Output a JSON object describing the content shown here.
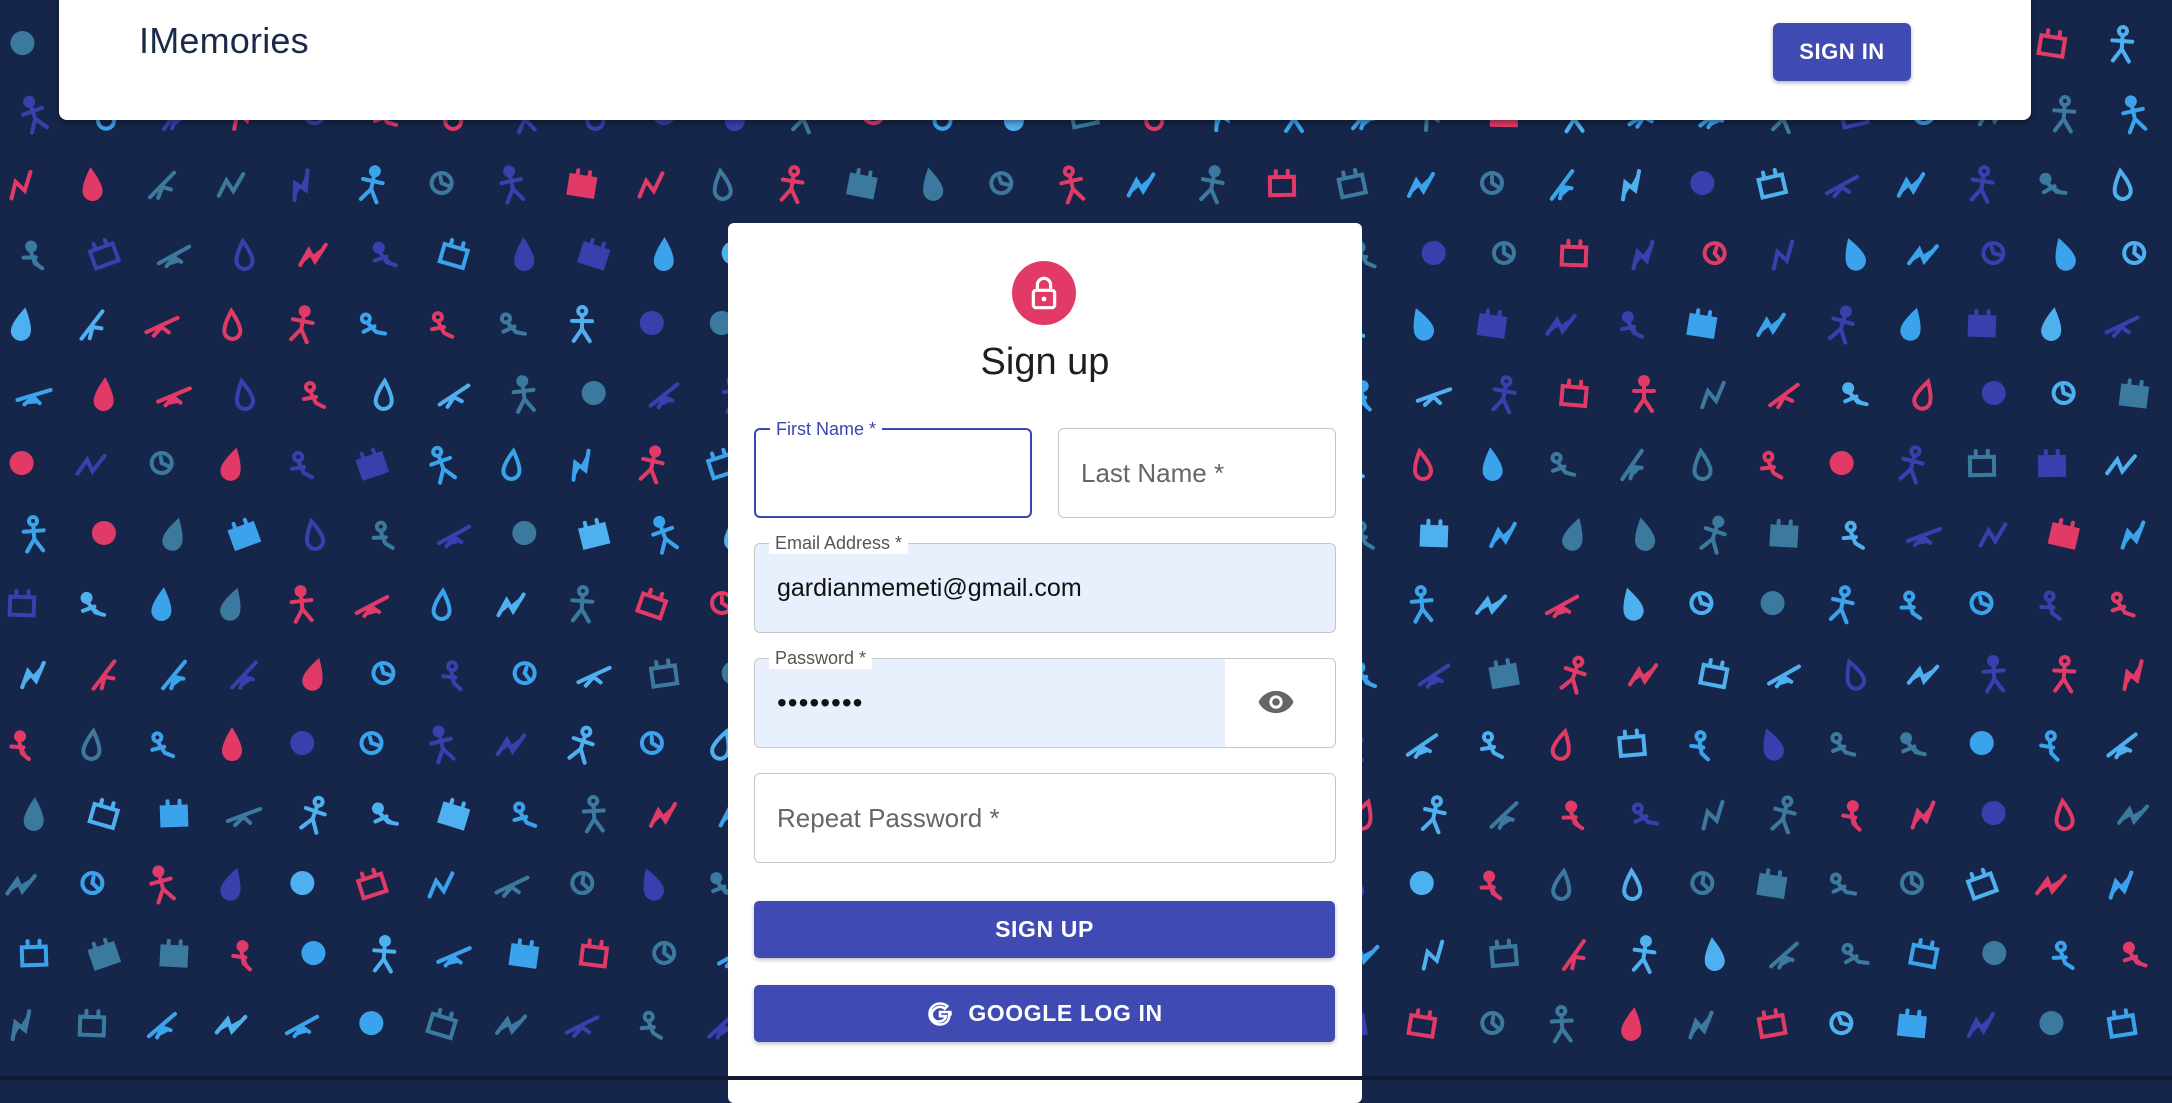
{
  "app": {
    "brand": "IMemories",
    "signin_label": "SIGN IN"
  },
  "form": {
    "title": "Sign up",
    "first_name": {
      "label": "First Name *",
      "value": ""
    },
    "last_name": {
      "placeholder": "Last Name *"
    },
    "email": {
      "label": "Email Address *",
      "value": "gardianmemeti@gmail.com"
    },
    "password": {
      "label": "Password *",
      "value": "••••••••"
    },
    "repeat_password": {
      "placeholder": "Repeat Password *"
    },
    "signup_label": "SIGN UP",
    "google_label": "GOOGLE LOG IN"
  },
  "colors": {
    "background": "#16264a",
    "primary": "#3f4bb3",
    "avatar": "#e23a66",
    "autofill": "#e8effd"
  },
  "icons": {
    "avatar": "lock-icon",
    "password_toggle": "eye-icon",
    "google": "google-g-icon"
  }
}
